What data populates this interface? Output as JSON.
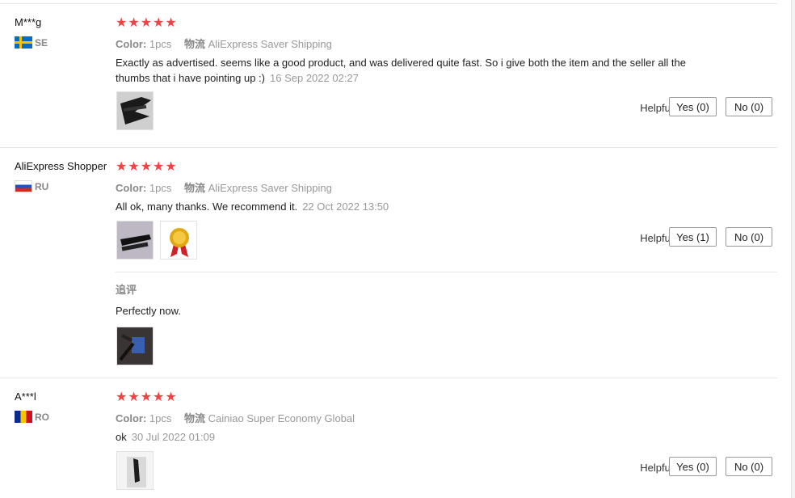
{
  "reviews": [
    {
      "user": "M***g",
      "country": "SE",
      "stars": "★★★★★",
      "color_key": "Color:",
      "color_val": "1pcs",
      "ship_key": "物流",
      "ship_val": "AliExpress Saver Shipping",
      "text": "Exactly as advertised. seems like a good product, and was delivered quite fast. So i give both the item and the seller all the thumbs that i have pointing up :)",
      "date": "16 Sep 2022 02:27",
      "helpful": "Helpful?",
      "yes": "Yes (0)",
      "no": "No (0)"
    },
    {
      "user": "AliExpress Shopper",
      "country": "RU",
      "stars": "★★★★★",
      "color_key": "Color:",
      "color_val": "1pcs",
      "ship_key": "物流",
      "ship_val": "AliExpress Saver Shipping",
      "text": "All ok, many thanks. We recommend it.",
      "date": "22 Oct 2022 13:50",
      "helpful": "Helpful?",
      "yes": "Yes (1)",
      "no": "No (0)",
      "followup_label": "追评",
      "followup_text": "Perfectly now."
    },
    {
      "user": "A***l",
      "country": "RO",
      "stars": "★★★★★",
      "color_key": "Color:",
      "color_val": "1pcs",
      "ship_key": "物流",
      "ship_val": "Cainiao Super Economy Global",
      "text": "ok",
      "date": "30 Jul 2022 01:09",
      "helpful": "Helpful?",
      "yes": "Yes (0)",
      "no": "No (0)"
    }
  ],
  "colors": {
    "star": "#ee4444",
    "divider": "#e8e8e8",
    "meta_text": "#999999"
  }
}
